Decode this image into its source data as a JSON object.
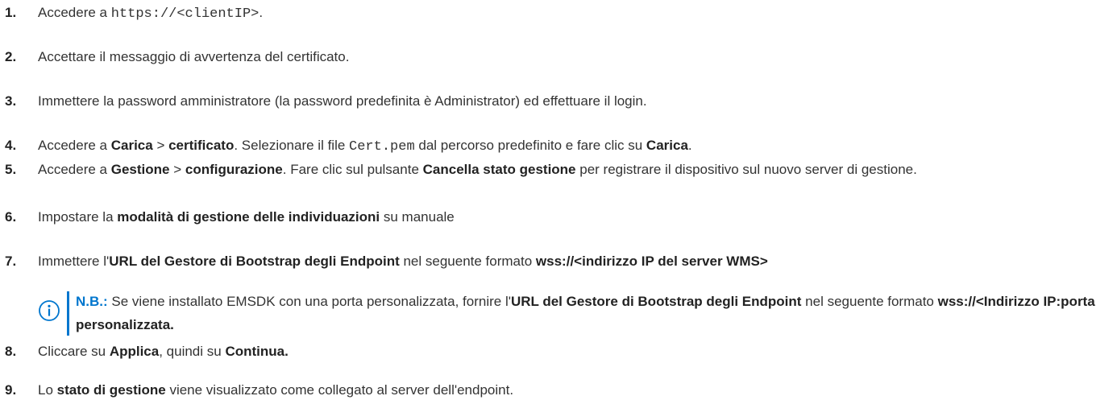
{
  "colors": {
    "accent": "#0076ce",
    "text": "#333333"
  },
  "steps": [
    {
      "num": "1.",
      "a": "Accedere a ",
      "code": "https://<clientIP>",
      "b": "."
    },
    {
      "num": "2.",
      "a": "Accettare il messaggio di avvertenza del certificato."
    },
    {
      "num": "3.",
      "a": "Immettere la password amministratore (la password predefinita è Administrator) ed effettuare il login."
    },
    {
      "num": "4.",
      "a": "Accedere a ",
      "b1": "Carica",
      "c": " > ",
      "b2": "certificato",
      "d": ". Selezionare il file ",
      "code": "Cert.pem",
      "e": " dal percorso predefinito e fare clic su ",
      "b3": "Carica",
      "f": "."
    },
    {
      "num": "5.",
      "a": "Accedere a ",
      "b1": "Gestione",
      "c": " > ",
      "b2": "configurazione",
      "d": ". Fare clic sul pulsante ",
      "b3": "Cancella stato gestione",
      "e": " per registrare il dispositivo sul nuovo server di gestione."
    },
    {
      "num": "6.",
      "a": "Impostare la ",
      "b1": "modalità di gestione delle individuazioni",
      "c": " su manuale"
    },
    {
      "num": "7.",
      "a": "Immettere l'",
      "b1": "URL del Gestore di Bootstrap degli Endpoint",
      "c": " nel seguente formato ",
      "b2": "wss://<indirizzo IP del server WMS>"
    },
    {
      "num": "8.",
      "a": "Cliccare su ",
      "b1": "Applica",
      "c": ", quindi su ",
      "b2": "Continua."
    },
    {
      "num": "9.",
      "a": "Lo ",
      "b1": "stato di gestione",
      "c": " viene visualizzato come collegato al server dell'endpoint."
    }
  ],
  "note": {
    "icon": "info-icon",
    "label": "N.B.:",
    "a": " Se viene installato EMSDK con una porta personalizzata, fornire l'",
    "b1": "URL del Gestore di Bootstrap degli Endpoint",
    "c": " nel seguente formato ",
    "b2": "wss://<Indirizzo IP:porta personalizzata."
  }
}
